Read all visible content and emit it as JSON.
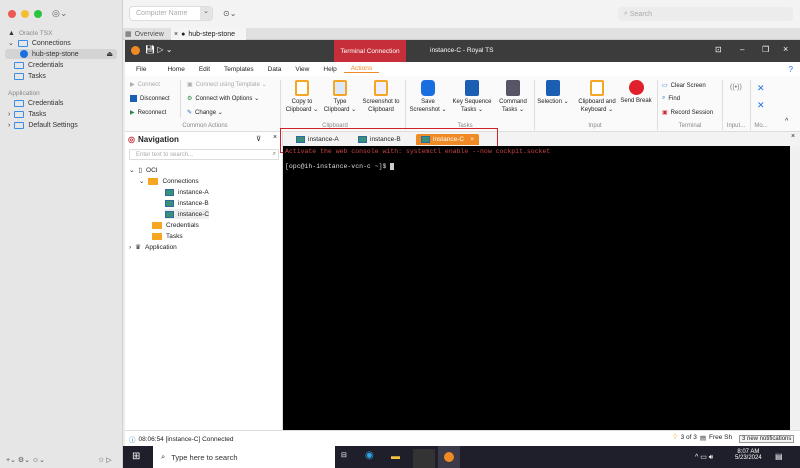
{
  "mac_sidebar": {
    "root": "Oracle TSX",
    "connections": "Connections",
    "selected": "hub-step-stone",
    "credentials": "Credentials",
    "tasks": "Tasks",
    "application_header": "Application",
    "app_credentials": "Credentials",
    "app_tasks": "Tasks",
    "default_settings": "Default Settings"
  },
  "topbar": {
    "computer_name_placeholder": "Computer Name",
    "search_placeholder": "Search"
  },
  "tabs": [
    {
      "label": "Overview"
    },
    {
      "label": "hub-step-stone"
    }
  ],
  "window": {
    "context_tab": "Terminal Connection",
    "title": "instance-C - Royal TS"
  },
  "menu": [
    "File",
    "Home",
    "Edit",
    "Templates",
    "Data",
    "View",
    "Help",
    "Actions"
  ],
  "ribbon": {
    "connect": "Connect",
    "disconnect": "Disconnect",
    "reconnect": "Reconnect",
    "connect_template": "Connect using Template ⌄",
    "connect_options": "Connect with Options ⌄",
    "change": "Change ⌄",
    "common_actions": "Common Actions",
    "copy_clipboard": "Copy to Clipboard ⌄",
    "type_clipboard": "Type Clipboard ⌄",
    "screenshot_clipboard": "Screenshot to Clipboard",
    "clipboard_group": "Clipboard",
    "save_screenshot": "Save Screenshot ⌄",
    "key_sequence": "Key Sequence Tasks ⌄",
    "command_tasks": "Command Tasks ⌄",
    "tasks_group": "Tasks",
    "selection": "Selection ⌄",
    "clipboard_keyboard": "Clipboard and Keyboard ⌄",
    "send_break": "Send Break",
    "input_group": "Input",
    "clear_screen": "Clear Screen",
    "find": "Find",
    "record_session": "Record Session",
    "terminal_group": "Terminal",
    "input_more": "Input...",
    "mo": "Mo..."
  },
  "navigation": {
    "title": "Navigation",
    "search_placeholder": "Enter text to search...",
    "tree": {
      "root": "OCI",
      "connections": "Connections",
      "items": [
        "instance-A",
        "instance-B",
        "instance-C"
      ],
      "credentials": "Credentials",
      "tasks": "Tasks",
      "application": "Application"
    }
  },
  "doc_tabs": [
    "instance-A",
    "instance-B",
    "instance-C"
  ],
  "terminal": {
    "line1": "Activate the web console with: systemctl enable --now cockpit.socket",
    "line2": "[opc@ih-instance-vcn-c ~]$ "
  },
  "status": {
    "message": "08:06:54 [instance-C] Connected",
    "count": "3 of 3",
    "free": "Free Sh",
    "tooltip": "3 new notifications"
  },
  "taskbar": {
    "search_placeholder": "Type here to search",
    "time": "8:07 AM",
    "date": "5/23/2024"
  },
  "colors": {
    "accent": "#f08a24",
    "context_tab": "#c62f3a",
    "highlight_box": "#d0202a"
  }
}
